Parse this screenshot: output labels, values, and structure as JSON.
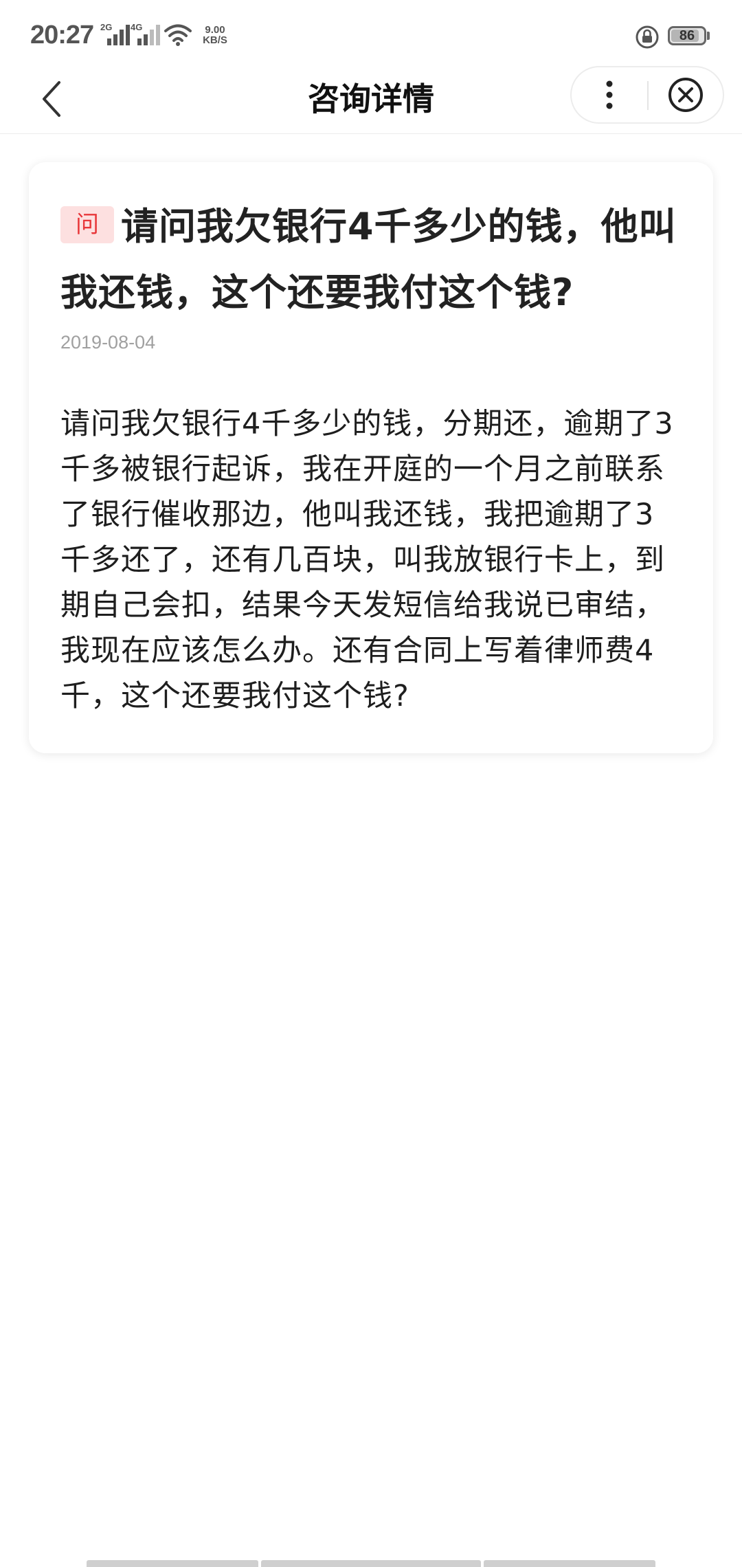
{
  "status_bar": {
    "time": "20:27",
    "network1": "2G",
    "network2": "4G",
    "speed_value": "9.00",
    "speed_unit": "KB/S",
    "battery": "86",
    "battery_level": 0.86
  },
  "nav": {
    "title": "咨询详情"
  },
  "question": {
    "badge": "问",
    "title": "请问我欠银行4千多少的钱，他叫我还钱，这个还要我付这个钱?",
    "date": "2019-08-04",
    "body": "请问我欠银行4千多少的钱，分期还，逾期了3千多被银行起诉，我在开庭的一个月之前联系了银行催收那边，他叫我还钱，我把逾期了3千多还了，还有几百块，叫我放银行卡上，到期自己会扣，结果今天发短信给我说已审结，我现在应该怎么办。还有合同上写着律师费4千，这个还要我付这个钱?"
  },
  "icons": {
    "back": "chevron-left-icon",
    "more": "more-vertical-icon",
    "close": "close-circle-icon",
    "wifi": "wifi-icon",
    "lock": "rotation-lock-icon"
  },
  "colors": {
    "badge_bg": "#fde0e0",
    "badge_text": "#e8373a",
    "title_text": "#222222",
    "date_text": "#a0a0a0"
  }
}
